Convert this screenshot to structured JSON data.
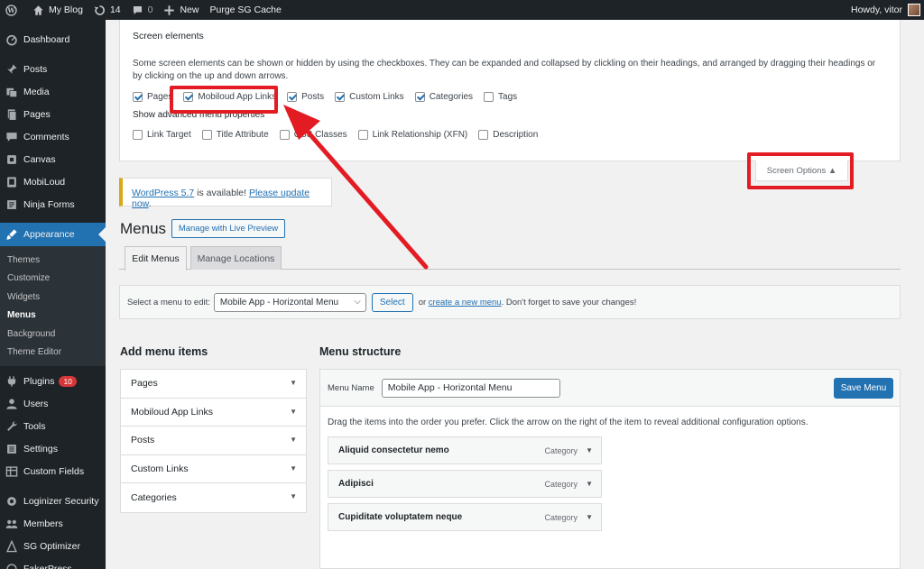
{
  "adminbar": {
    "site_name": "My Blog",
    "updates_count": "14",
    "comments_count": "0",
    "new_label": "New",
    "purge_label": "Purge SG Cache",
    "howdy": "Howdy, vitor"
  },
  "sidebar": {
    "items_top": [
      {
        "label": "Dashboard",
        "icon": "dashboard-icon"
      },
      {
        "label": "Posts",
        "icon": "pin-icon"
      },
      {
        "label": "Media",
        "icon": "media-icon"
      },
      {
        "label": "Pages",
        "icon": "pages-icon"
      },
      {
        "label": "Comments",
        "icon": "comments-icon"
      },
      {
        "label": "Canvas",
        "icon": "canvas-icon"
      },
      {
        "label": "MobiLoud",
        "icon": "mobiloud-icon"
      },
      {
        "label": "Ninja Forms",
        "icon": "forms-icon"
      }
    ],
    "appearance": {
      "label": "Appearance",
      "icon": "brush-icon"
    },
    "submenu": [
      "Themes",
      "Customize",
      "Widgets",
      "Menus",
      "Background",
      "Theme Editor"
    ],
    "submenu_current": "Menus",
    "items_bottom": [
      {
        "label": "Plugins",
        "icon": "plugin-icon",
        "badge": "10"
      },
      {
        "label": "Users",
        "icon": "users-icon"
      },
      {
        "label": "Tools",
        "icon": "tools-icon"
      },
      {
        "label": "Settings",
        "icon": "settings-icon"
      },
      {
        "label": "Custom Fields",
        "icon": "fields-icon"
      }
    ],
    "items_extra": [
      {
        "label": "Loginizer Security",
        "icon": "gear-icon"
      },
      {
        "label": "Members",
        "icon": "members-icon"
      },
      {
        "label": "SG Optimizer",
        "icon": "optimizer-icon"
      },
      {
        "label": "FakerPress",
        "icon": "faker-icon"
      }
    ]
  },
  "screen_options": {
    "title": "Screen elements",
    "description": "Some screen elements can be shown or hidden by using the checkboxes. They can be expanded and collapsed by clickling on their headings, and arranged by dragging their headings or by clicking on the up and down arrows.",
    "boxes": [
      {
        "label": "Pages",
        "checked": true
      },
      {
        "label": "Mobiloud App Links",
        "checked": true
      },
      {
        "label": "Posts",
        "checked": true
      },
      {
        "label": "Custom Links",
        "checked": true
      },
      {
        "label": "Categories",
        "checked": true
      },
      {
        "label": "Tags",
        "checked": false
      }
    ],
    "advanced_title": "Show advanced menu properties",
    "advanced": [
      {
        "label": "Link Target",
        "checked": false
      },
      {
        "label": "Title Attribute",
        "checked": false
      },
      {
        "label": "CSS Classes",
        "checked": false
      },
      {
        "label": "Link Relationship (XFN)",
        "checked": false
      },
      {
        "label": "Description",
        "checked": false
      }
    ],
    "tab_label": "Screen Options ▲"
  },
  "notice": {
    "link1": "WordPress 5.7",
    "middle": " is available! ",
    "link2": "Please update now",
    "end": "."
  },
  "page": {
    "title": "Menus",
    "live_preview": "Manage with Live Preview",
    "tab_edit": "Edit Menus",
    "tab_locations": "Manage Locations"
  },
  "select_bar": {
    "label": "Select a menu to edit:",
    "selected_menu": "Mobile App - Horizontal Menu",
    "select_button": "Select",
    "or": "or",
    "create_link": "create a new menu",
    "tail": ". Don't forget to save your changes!"
  },
  "add_items": {
    "title": "Add menu items",
    "sections": [
      "Pages",
      "Mobiloud App Links",
      "Posts",
      "Custom Links",
      "Categories"
    ]
  },
  "menu_structure": {
    "title": "Menu structure",
    "name_label": "Menu Name",
    "name_value": "Mobile App - Horizontal Menu",
    "save_button": "Save Menu",
    "instructions": "Drag the items into the order you prefer. Click the arrow on the right of the item to reveal additional configuration options.",
    "items": [
      {
        "title": "Aliquid consectetur nemo",
        "type": "Category"
      },
      {
        "title": "Adipisci",
        "type": "Category"
      },
      {
        "title": "Cupiditate voluptatem neque",
        "type": "Category"
      }
    ]
  },
  "colors": {
    "admin_dark": "#1d2327",
    "accent_blue": "#2271b1",
    "highlight_red": "#e31b23",
    "notice_yellow": "#dba617"
  }
}
